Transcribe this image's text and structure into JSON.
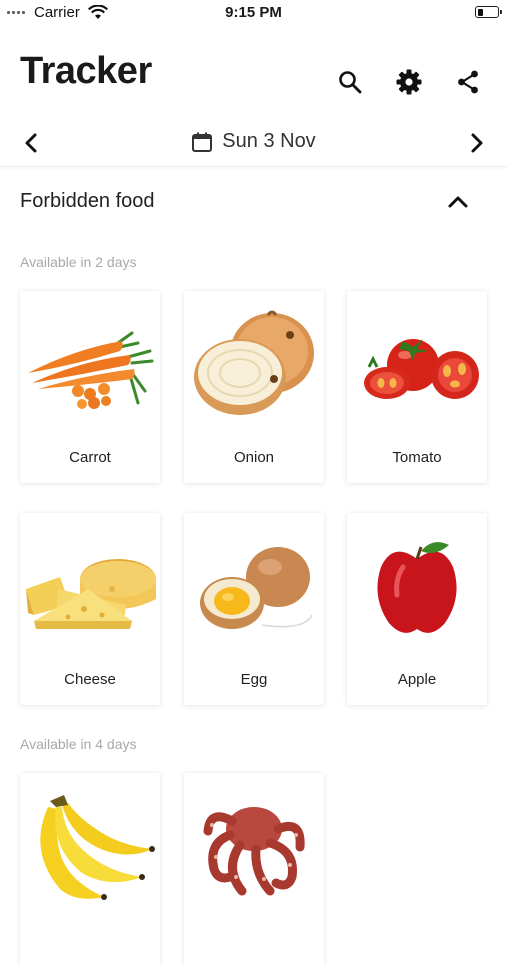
{
  "status_bar": {
    "carrier": "Carrier",
    "time": "9:15 PM",
    "battery_level": 0.3
  },
  "header": {
    "title": "Tracker",
    "icons": [
      "search-icon",
      "gear-icon",
      "share-icon"
    ]
  },
  "date_nav": {
    "date": "Sun 3 Nov",
    "icons": [
      "chevron-left-icon",
      "calendar-icon",
      "chevron-right-icon"
    ]
  },
  "section": {
    "title": "Forbidden food",
    "expanded": true
  },
  "groups": [
    {
      "label": "Available in 2 days",
      "items": [
        {
          "name": "Carrot",
          "icon": "carrot-image"
        },
        {
          "name": "Onion",
          "icon": "onion-image"
        },
        {
          "name": "Tomato",
          "icon": "tomato-image"
        },
        {
          "name": "Cheese",
          "icon": "cheese-image"
        },
        {
          "name": "Egg",
          "icon": "egg-image"
        },
        {
          "name": "Apple",
          "icon": "apple-image"
        }
      ]
    },
    {
      "label": "Available in 4 days",
      "items": [
        {
          "name": "Banana",
          "icon": "banana-image"
        },
        {
          "name": "Octopus",
          "icon": "octopus-image"
        }
      ]
    }
  ],
  "colors": {
    "text": "#1a1a1a",
    "muted": "#a8a8a8",
    "card_shadow": "#e6e6e6"
  }
}
